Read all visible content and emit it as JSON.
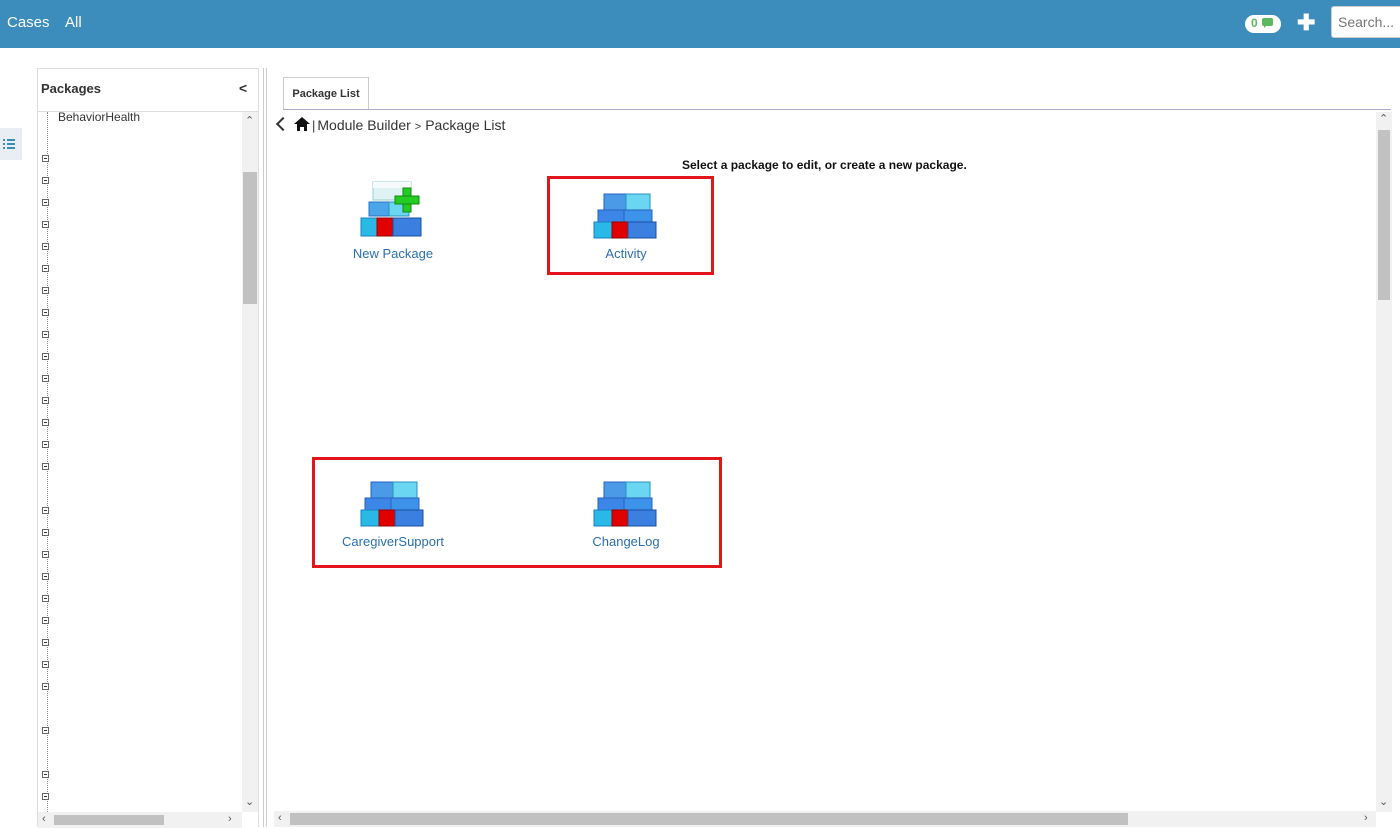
{
  "topbar": {
    "nav": [
      "Cases",
      "All"
    ],
    "notifications_count": "0",
    "search_placeholder": "Search..."
  },
  "sidebar": {
    "title": "Packages",
    "collapse_label": "<",
    "first_item": "BehaviorHealth"
  },
  "main": {
    "tab_label": "Package List",
    "breadcrumb": {
      "separator": "|",
      "module_builder": "Module Builder",
      "arrow": ">",
      "current": "Package List"
    },
    "instruction": "Select a package to edit, or create a new package.",
    "packages": [
      {
        "label": "New Package",
        "icon": "new-package-icon"
      },
      {
        "label": "Activity",
        "icon": "package-icon"
      },
      {
        "label": "CaregiverSupport",
        "icon": "package-icon"
      },
      {
        "label": "ChangeLog",
        "icon": "package-icon"
      }
    ]
  },
  "colors": {
    "header": "#3c8dbc",
    "link": "#2a6fb0",
    "highlight_border": "#e2141c"
  }
}
